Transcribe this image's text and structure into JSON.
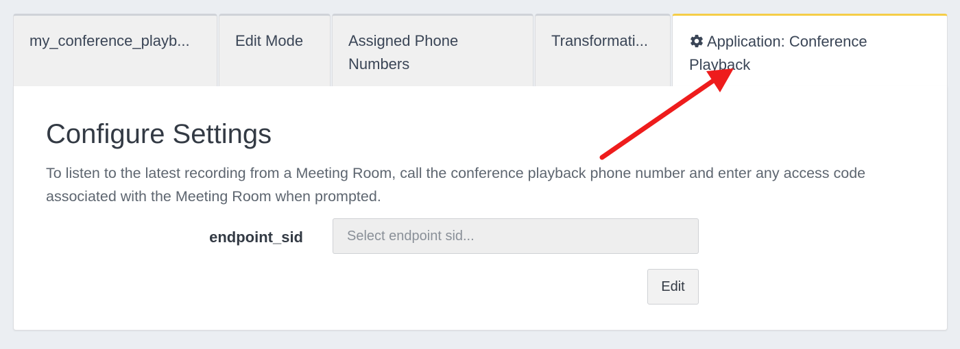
{
  "tabs": [
    {
      "label": "my_conference_playb..."
    },
    {
      "label": "Edit Mode"
    },
    {
      "label": "Assigned Phone Numbers"
    },
    {
      "label": "Transformati..."
    },
    {
      "label": "Application: Conference Playback",
      "icon": "gear-icon",
      "active": true
    }
  ],
  "colors": {
    "active_tab_accent": "#f5cd47",
    "annotation_arrow": "#ee1c1c"
  },
  "main": {
    "title": "Configure Settings",
    "description": "To listen to the latest recording from a Meeting Room, call the conference playback phone number and enter any access code associated with the Meeting Room when prompted.",
    "field_label": "endpoint_sid",
    "select_placeholder": "Select endpoint sid...",
    "edit_label": "Edit"
  }
}
